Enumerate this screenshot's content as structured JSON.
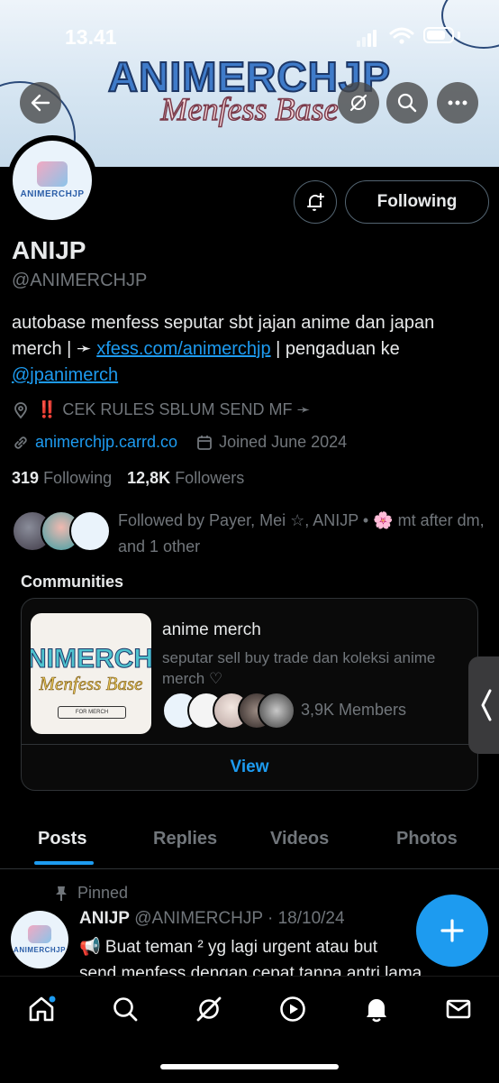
{
  "status_bar": {
    "time": "13.41"
  },
  "banner": {
    "brand_title": "ANIMERCHJP",
    "brand_subtitle": "Menfess Base"
  },
  "profile": {
    "avatar_text": "ANIMERCHJP",
    "name": "ANIJP",
    "handle": "@ANIMERCHJP",
    "following_button": "Following",
    "bio_prefix": "autobase menfess seputar sbt jajan anime dan japan merch | ➛ ",
    "bio_link": "xfess.com/animerchjp",
    "bio_middle": " | pengaduan ke ",
    "bio_mention": "@jpanimerch",
    "location": "CEK RULES SBLUM SEND MF ➛",
    "location_emoji": "‼️",
    "website": "animerchjp.carrd.co",
    "joined": "Joined June 2024",
    "following_count": "319",
    "following_label": "Following",
    "followers_count": "12,8K",
    "followers_label": "Followers",
    "followed_by": "Followed by Payer, Mei ☆, ANIJP • 🌸 mt after dm, and 1 other"
  },
  "communities": {
    "label": "Communities",
    "card": {
      "thumb_title": "NIMERCHJ",
      "thumb_subtitle": "Menfess Base",
      "thumb_badge": "FOR MERCH",
      "name": "anime merch",
      "description": "seputar sell buy trade dan koleksi anime merch ♡",
      "members": "3,9K Members",
      "view_label": "View"
    }
  },
  "tabs": [
    {
      "label": "Posts",
      "active": true
    },
    {
      "label": "Replies",
      "active": false
    },
    {
      "label": "Videos",
      "active": false
    },
    {
      "label": "Photos",
      "active": false
    }
  ],
  "post": {
    "pinned_label": "Pinned",
    "author": "ANIJP",
    "handle_date": "@ANIMERCHJP · 18/10/24",
    "text_line1": "📢 Buat teman ² yg lagi urgent atau but",
    "text_line2": "send menfess dengan cepat tanpa antri lama"
  },
  "colors": {
    "accent": "#1d9bf0",
    "background": "#000000",
    "muted": "#71767b"
  },
  "icons": [
    "back-arrow-icon",
    "grok-icon",
    "search-icon",
    "more-icon",
    "notify-bell-plus-icon",
    "location-pin-icon",
    "link-icon",
    "calendar-icon",
    "pin-icon",
    "compose-plus-icon",
    "home-icon",
    "explore-icon",
    "grok-nav-icon",
    "video-play-icon",
    "notifications-bell-icon",
    "messages-mail-icon",
    "chevron-left-icon"
  ]
}
